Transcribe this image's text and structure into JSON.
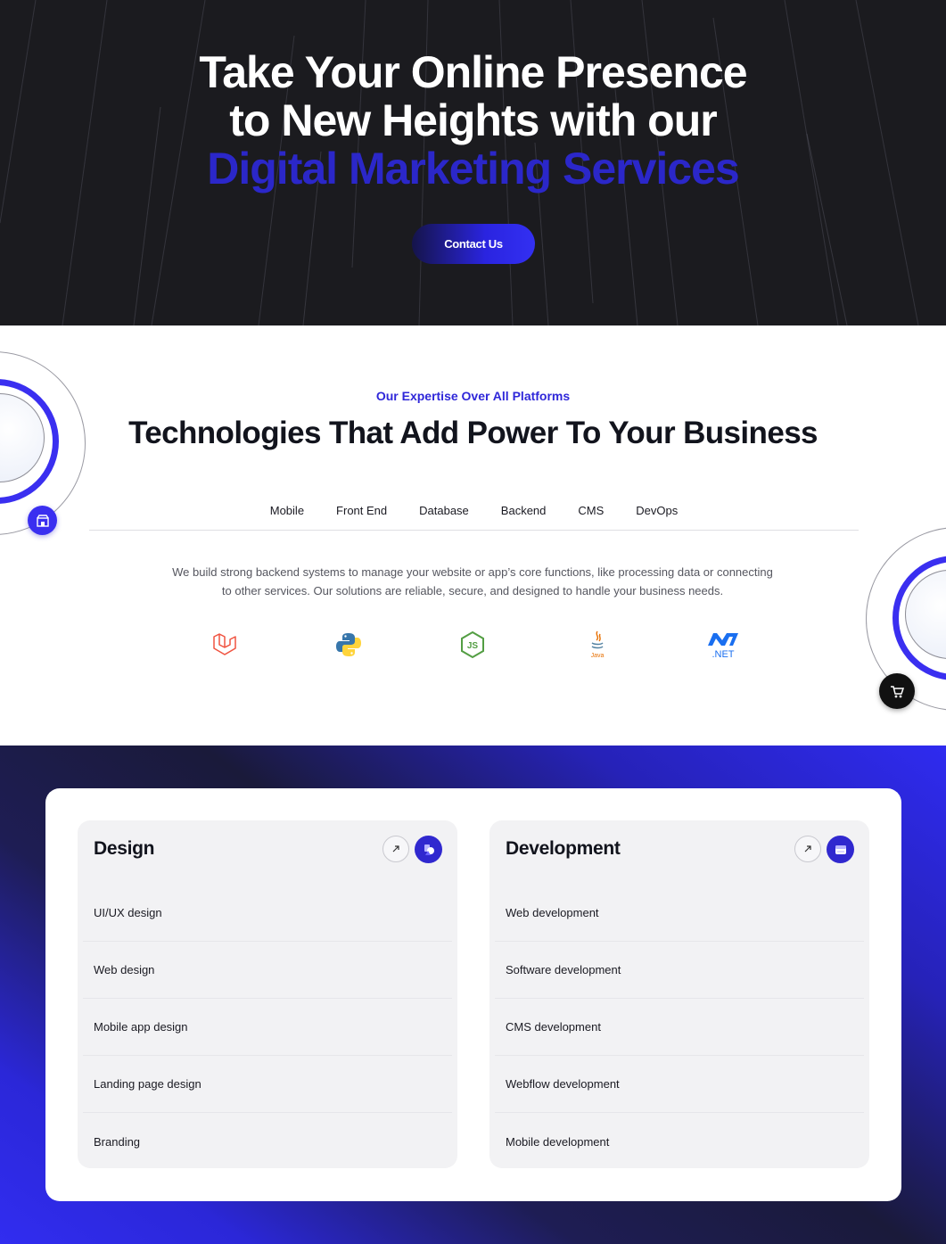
{
  "hero": {
    "title_line1": "Take Your Online Presence",
    "title_line2": "to New Heights with our",
    "title_accent": "Digital Marketing Services",
    "contact_label": "Contact Us"
  },
  "technologies": {
    "eyebrow": "Our Expertise Over All Platforms",
    "title": "Technologies That Add Power To Your Business",
    "tabs": [
      "Mobile",
      "Front End",
      "Database",
      "Backend",
      "CMS",
      "DevOps"
    ],
    "description": "We build strong backend systems to manage your website or app’s core functions, like processing data or connecting to other services. Our solutions are reliable, secure, and designed to handle your business needs.",
    "logos": [
      {
        "icon": "laravel-icon",
        "color": "#f05340"
      },
      {
        "icon": "python-icon",
        "color": "#3776ab"
      },
      {
        "icon": "nodejs-icon",
        "color": "#539e43"
      },
      {
        "icon": "java-icon",
        "color": "#e76f00",
        "text": "Java"
      },
      {
        "icon": "dotnet-icon",
        "color": "#1a6ff0",
        "text": ".NET"
      }
    ]
  },
  "services": {
    "design": {
      "title": "Design",
      "items": [
        "UI/UX design",
        "Web design",
        "Mobile app design",
        "Landing page design",
        "Branding"
      ]
    },
    "development": {
      "title": "Development",
      "items": [
        "Web development",
        "Software development",
        "CMS development",
        "Webflow development",
        "Mobile development"
      ]
    }
  },
  "colors": {
    "accent": "#2f27d9",
    "hero_bg": "#1b1b1f",
    "title_dark": "#12141d"
  }
}
